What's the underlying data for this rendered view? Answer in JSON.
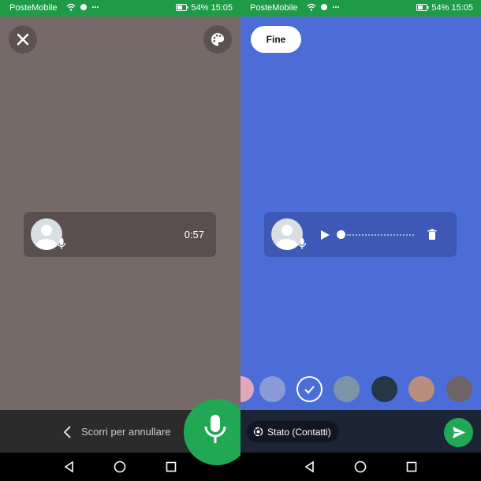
{
  "status_bar": {
    "carrier": "PosteMobile",
    "icons": [
      "wifi-icon",
      "signal-icon",
      "play-store-icon",
      "instagram-icon",
      "chat-icon",
      "more-dots-icon"
    ],
    "right_icons": [
      "nfc-icon",
      "bluetooth-icon",
      "vibrate-icon"
    ],
    "battery": "54%",
    "time": "15:05"
  },
  "left_panel": {
    "background": "#766a69",
    "voice_card": {
      "duration": "0:57"
    },
    "swipe_hint": "Scorri per annullare"
  },
  "right_panel": {
    "background": "#4c6cd8",
    "done_label": "Fine",
    "audience_label": "Stato (Contatti)",
    "color_swatches": [
      {
        "color": "#e2a6bd",
        "selected": false
      },
      {
        "color": "#8a9ad9",
        "selected": false
      },
      {
        "color": "#4c6cd8",
        "selected": true
      },
      {
        "color": "#7d93a8",
        "selected": false
      },
      {
        "color": "#253645",
        "selected": false
      },
      {
        "color": "#b88f7c",
        "selected": false
      },
      {
        "color": "#6e6467",
        "selected": false
      }
    ]
  },
  "colors": {
    "accent_green": "#20a855",
    "statusbar_green": "#1f9b47"
  }
}
